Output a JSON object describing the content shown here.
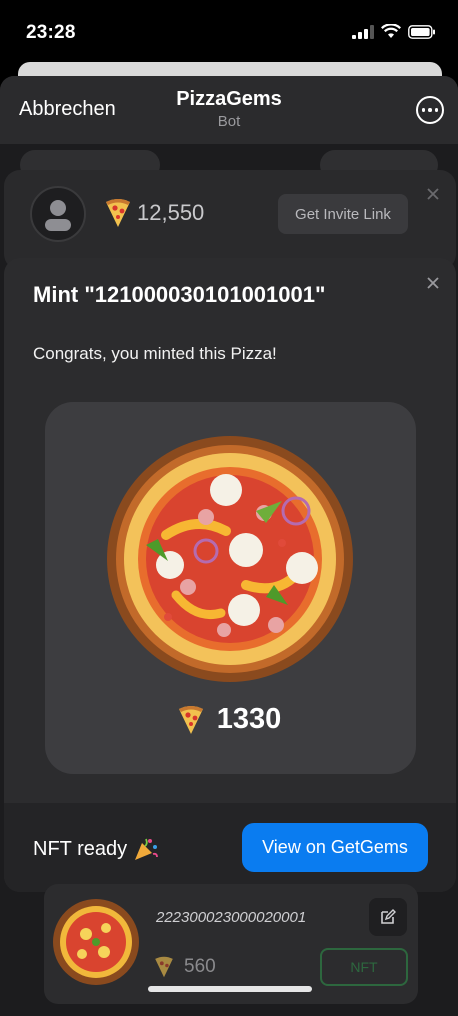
{
  "status_bar": {
    "time": "23:28"
  },
  "header": {
    "cancel_label": "Abbrechen",
    "title": "PizzaGems",
    "subtitle": "Bot"
  },
  "profile": {
    "balance": "12,550",
    "invite_label": "Get Invite Link"
  },
  "modal": {
    "title": "Mint \"121000030101001001\"",
    "message": "Congrats, you minted this Pizza!",
    "price": "1330",
    "nft_ready_label": "NFT ready",
    "view_button_label": "View on GetGems"
  },
  "bottom_card": {
    "pizza_id": "222300023000020001",
    "price": "560",
    "nft_label": "NFT"
  },
  "colors": {
    "accent": "#0a7cf0",
    "background": "#1c1c1e",
    "card": "#2c2c2e"
  }
}
